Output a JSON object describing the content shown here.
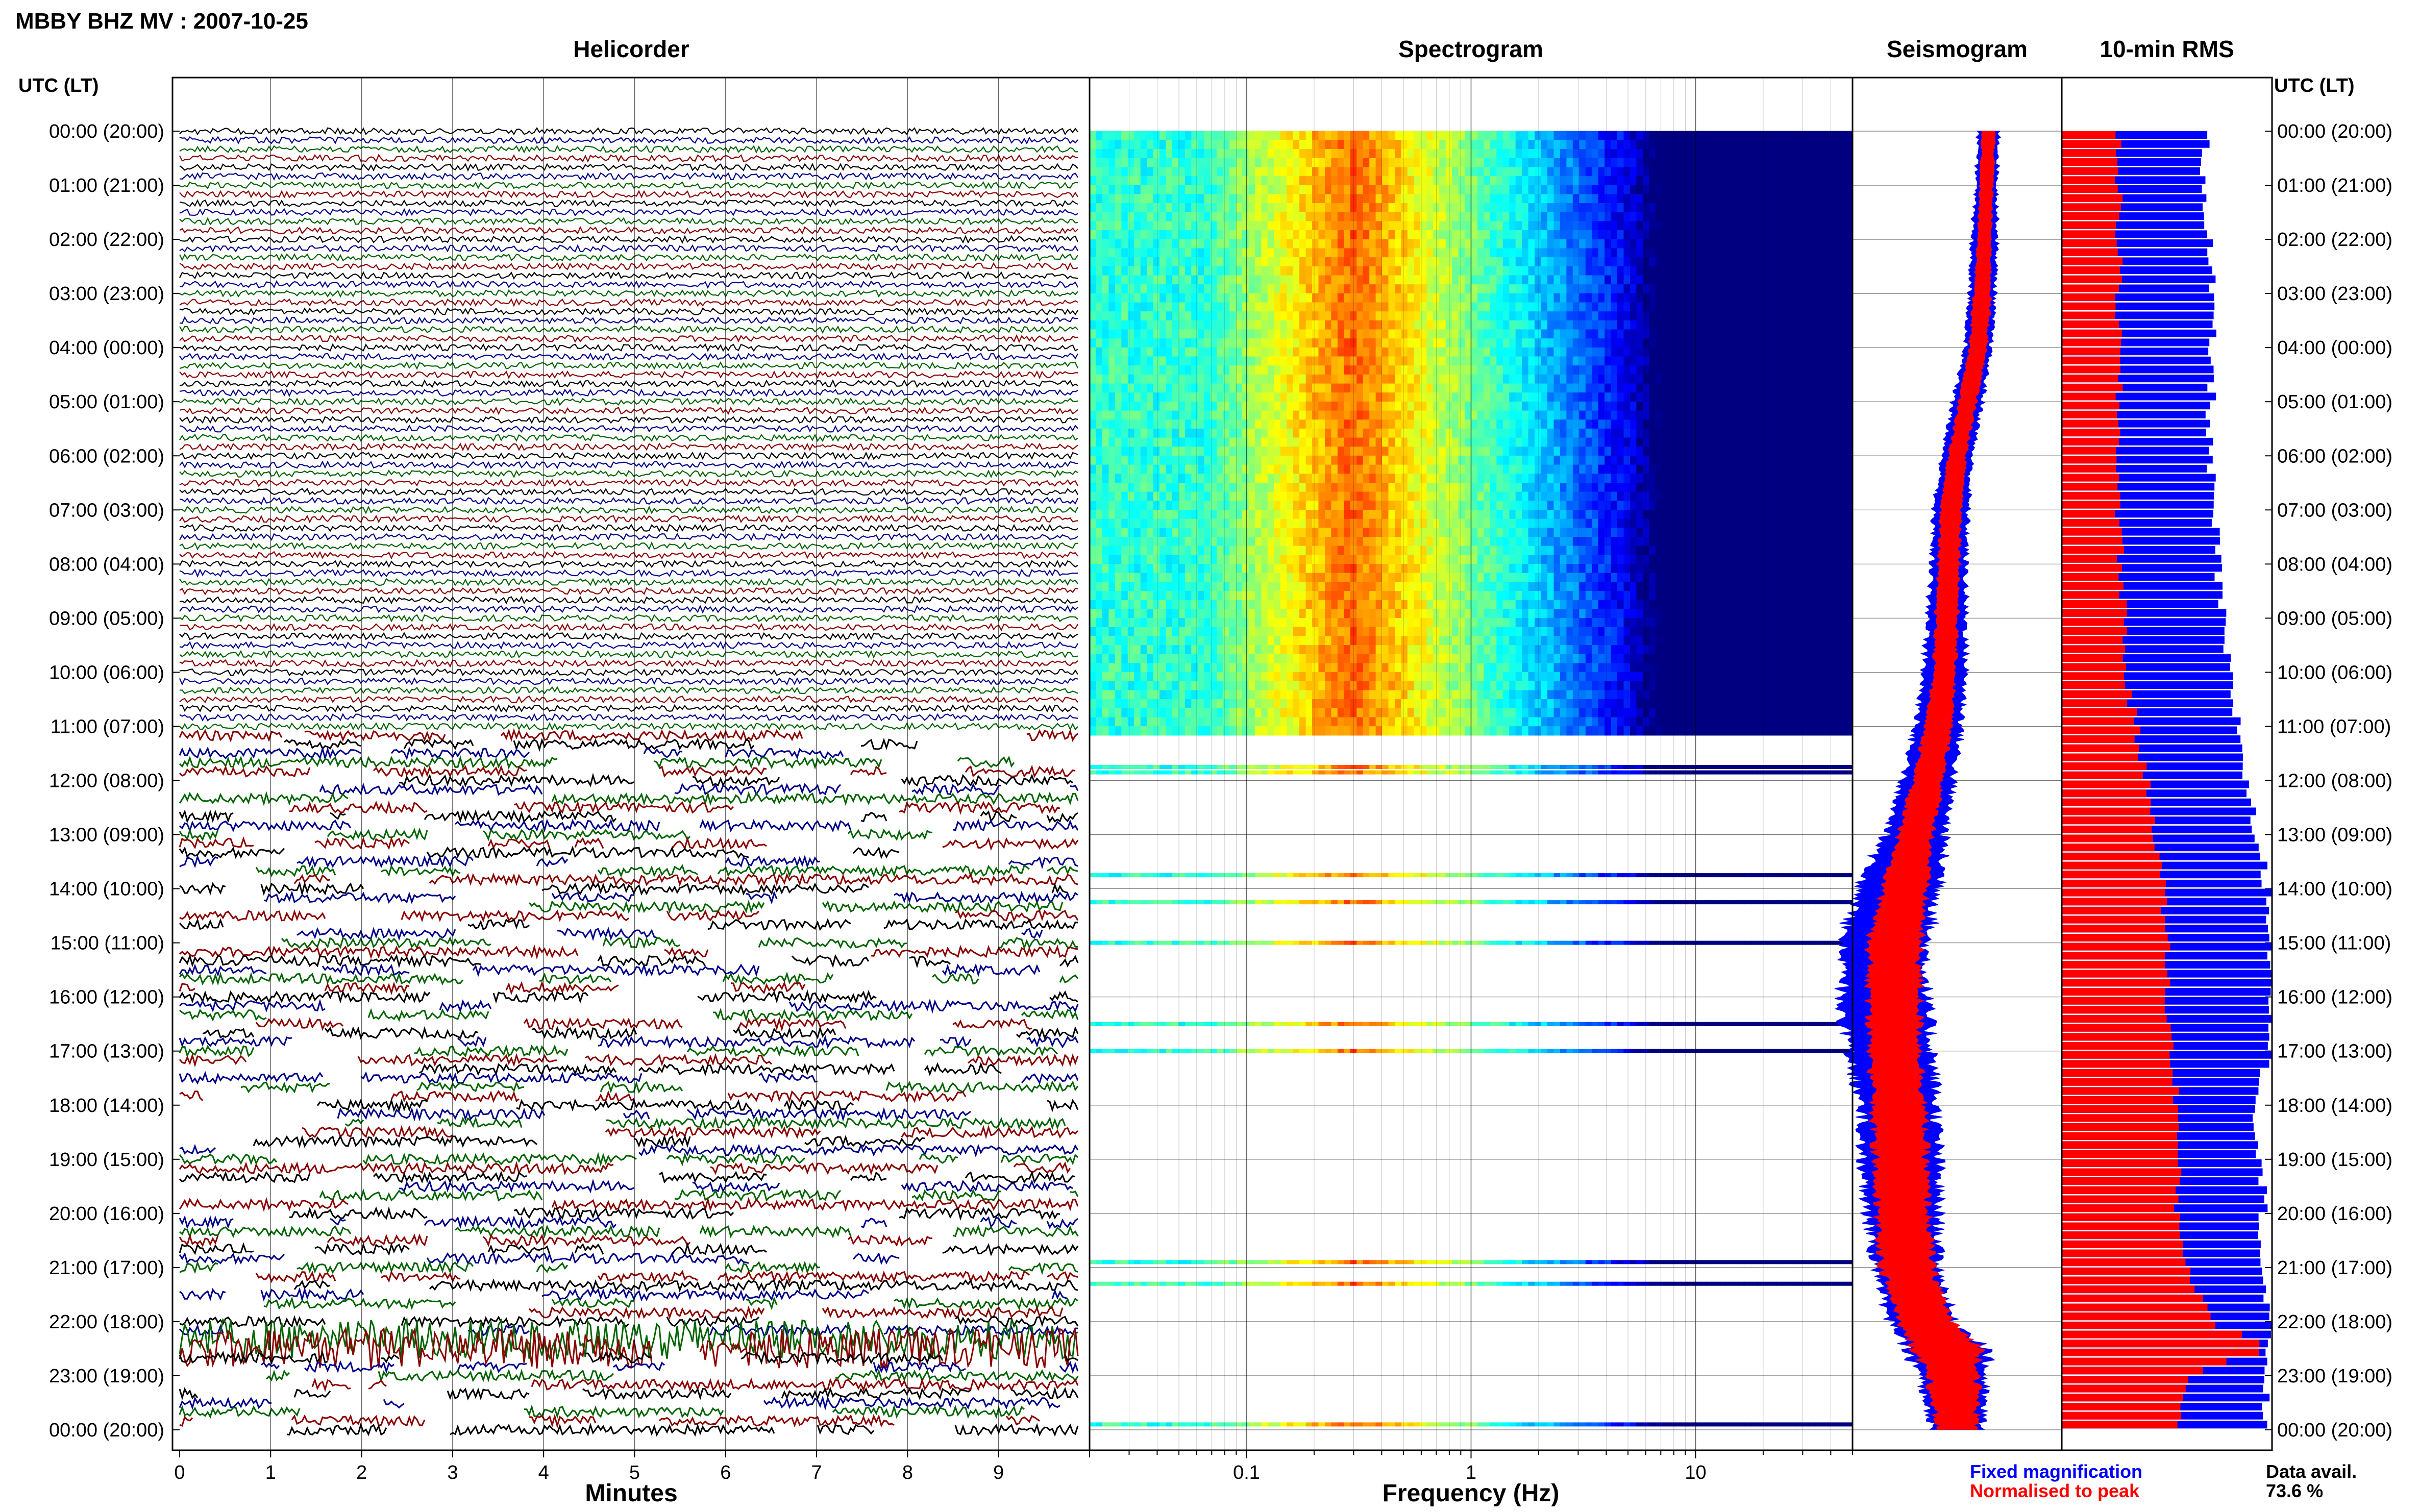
{
  "header": {
    "title": "MBBY BHZ MV : 2007-10-25"
  },
  "colors": {
    "trace_cycle": [
      "#000000",
      "#00008b",
      "#006400",
      "#8b0000"
    ],
    "fixed_magnification": "#0000ff",
    "normalised_to_peak": "#ff0000",
    "spectrogram_colormap": "jet"
  },
  "chart_data": [
    {
      "type": "line",
      "panel": "helicorder",
      "title": "Helicorder",
      "xlabel": "Minutes",
      "ylabel": "UTC (LT)",
      "x_ticks": [
        "0",
        "1",
        "2",
        "3",
        "4",
        "5",
        "6",
        "7",
        "8",
        "9"
      ],
      "xlim": [
        0,
        10
      ],
      "y_tick_labels": [
        "00:00 (20:00)",
        "01:00 (21:00)",
        "02:00 (22:00)",
        "03:00 (23:00)",
        "04:00 (00:00)",
        "05:00 (01:00)",
        "06:00 (02:00)",
        "07:00 (03:00)",
        "08:00 (04:00)",
        "09:00 (05:00)",
        "10:00 (06:00)",
        "11:00 (07:00)",
        "12:00 (08:00)",
        "13:00 (09:00)",
        "14:00 (10:00)",
        "15:00 (11:00)",
        "16:00 (12:00)",
        "17:00 (13:00)",
        "18:00 (14:00)",
        "19:00 (15:00)",
        "20:00 (16:00)",
        "21:00 (17:00)",
        "22:00 (18:00)",
        "23:00 (19:00)",
        "00:00 (20:00)"
      ],
      "lines_per_hour": 6,
      "continuous_until_hour": 11.1,
      "burst_hours": [
        22.2,
        22.6
      ]
    },
    {
      "type": "heatmap",
      "panel": "spectrogram",
      "title": "Spectrogram",
      "xlabel": "Frequency (Hz)",
      "x_scale": "log",
      "xlim": [
        0.02,
        50
      ],
      "x_ticks": [
        0.1,
        1,
        10
      ],
      "x_tick_labels": [
        "0.1",
        "1",
        "10"
      ],
      "peak_frequency_hz": 0.3,
      "data_rows_until_hour": 11.1,
      "isolated_rows_hours": [
        11.75,
        11.85,
        13.75,
        14.25,
        15.0,
        16.5,
        17.0,
        20.9,
        21.3,
        23.9
      ]
    },
    {
      "type": "area",
      "panel": "seismogram",
      "title": "Seismogram",
      "series": [
        {
          "name": "Fixed magnification",
          "hours": [
            0,
            1,
            2,
            3,
            4,
            5,
            6,
            7,
            8,
            9,
            10,
            11,
            12,
            13,
            14,
            15,
            16,
            17,
            18,
            19,
            20,
            21,
            22,
            22.5,
            23,
            24
          ],
          "center": [
            0.65,
            0.64,
            0.63,
            0.62,
            0.6,
            0.55,
            0.5,
            0.47,
            0.46,
            0.45,
            0.44,
            0.41,
            0.36,
            0.3,
            0.22,
            0.15,
            0.15,
            0.18,
            0.22,
            0.23,
            0.24,
            0.26,
            0.33,
            0.45,
            0.48,
            0.5
          ],
          "halfwidth": [
            0.05,
            0.05,
            0.06,
            0.06,
            0.06,
            0.07,
            0.07,
            0.08,
            0.08,
            0.09,
            0.1,
            0.11,
            0.12,
            0.14,
            0.2,
            0.2,
            0.2,
            0.2,
            0.18,
            0.18,
            0.17,
            0.15,
            0.15,
            0.2,
            0.15,
            0.12
          ]
        },
        {
          "name": "Normalised to peak",
          "hours": [
            0,
            1,
            2,
            3,
            4,
            5,
            6,
            7,
            8,
            9,
            10,
            11,
            12,
            13,
            14,
            15,
            16,
            17,
            18,
            19,
            20,
            21,
            22,
            22.5,
            23,
            24
          ],
          "center": [
            0.65,
            0.64,
            0.63,
            0.62,
            0.6,
            0.55,
            0.5,
            0.47,
            0.46,
            0.45,
            0.44,
            0.41,
            0.36,
            0.3,
            0.25,
            0.2,
            0.2,
            0.2,
            0.22,
            0.23,
            0.24,
            0.26,
            0.35,
            0.45,
            0.48,
            0.5
          ],
          "halfwidth": [
            0.03,
            0.03,
            0.03,
            0.04,
            0.04,
            0.04,
            0.04,
            0.05,
            0.05,
            0.05,
            0.05,
            0.06,
            0.07,
            0.08,
            0.1,
            0.12,
            0.12,
            0.12,
            0.12,
            0.12,
            0.12,
            0.12,
            0.12,
            0.16,
            0.12,
            0.09
          ]
        }
      ]
    },
    {
      "type": "bar",
      "panel": "10-min-rms",
      "title": "10-min RMS",
      "orientation": "horizontal",
      "interval_minutes": 10,
      "series": [
        {
          "name": "Fixed magnification",
          "hours": [
            0,
            1,
            2,
            3,
            4,
            5,
            6,
            7,
            8,
            9,
            10,
            11,
            12,
            13,
            14,
            15,
            16,
            17,
            18,
            19,
            20,
            21,
            22,
            23,
            24
          ],
          "values": [
            0.68,
            0.68,
            0.7,
            0.71,
            0.71,
            0.71,
            0.7,
            0.72,
            0.74,
            0.76,
            0.79,
            0.84,
            0.88,
            0.92,
            0.98,
            1.0,
            1.0,
            1.0,
            0.92,
            0.95,
            0.96,
            0.95,
            0.98,
            0.98,
            0.95
          ]
        },
        {
          "name": "Normalised to peak",
          "hours": [
            0,
            1,
            2,
            3,
            4,
            5,
            6,
            7,
            8,
            9,
            10,
            11,
            12,
            13,
            14,
            15,
            16,
            17,
            18,
            19,
            20,
            21,
            22,
            22.5,
            23,
            24
          ],
          "values": [
            0.27,
            0.27,
            0.27,
            0.27,
            0.27,
            0.27,
            0.27,
            0.27,
            0.28,
            0.3,
            0.3,
            0.35,
            0.4,
            0.45,
            0.48,
            0.5,
            0.5,
            0.52,
            0.55,
            0.55,
            0.55,
            0.6,
            0.7,
            1.0,
            0.6,
            0.55
          ]
        }
      ]
    }
  ],
  "legend": {
    "fixed_label": "Fixed magnification",
    "normalised_label": "Normalised to peak",
    "data_avail_label": "Data avail.",
    "data_avail_value": "73.6 %"
  }
}
